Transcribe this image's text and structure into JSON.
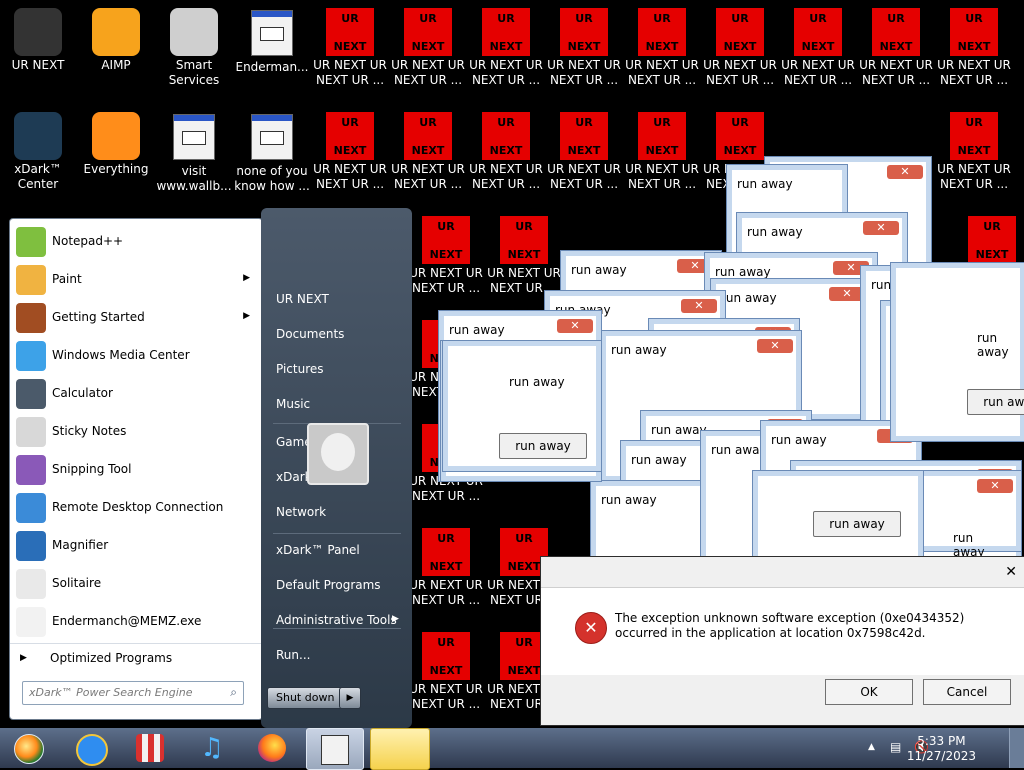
{
  "desktop_icons": {
    "row1": [
      {
        "label": "UR NEXT"
      },
      {
        "label": "AIMP"
      },
      {
        "label": "Smart Services"
      },
      {
        "label": "Enderman..."
      },
      {
        "label": "UR NEXT UR NEXT UR ..."
      },
      {
        "label": "UR NEXT UR NEXT UR ..."
      },
      {
        "label": "UR NEXT UR NEXT UR ..."
      },
      {
        "label": "UR NEXT UR NEXT UR ..."
      },
      {
        "label": "UR NEXT UR NEXT UR ..."
      },
      {
        "label": "UR NEXT UR NEXT UR ..."
      },
      {
        "label": "UR NEXT UR NEXT UR ..."
      },
      {
        "label": "UR NEXT UR NEXT UR ..."
      },
      {
        "label": "UR NEXT UR NEXT UR ..."
      }
    ],
    "row2": [
      {
        "label": "xDark™ Center"
      },
      {
        "label": "Everything"
      },
      {
        "label": "visit www.wallb..."
      },
      {
        "label": "none of you know how ..."
      },
      {
        "label": "UR NEXT UR NEXT UR ..."
      },
      {
        "label": "UR NEXT UR NEXT UR ..."
      },
      {
        "label": "UR NEXT UR NEXT UR ..."
      },
      {
        "label": "UR NEXT UR NEXT UR ..."
      },
      {
        "label": "UR NEXT UR NEXT UR ..."
      },
      {
        "label": "UR NEXT UR NEXT UR ..."
      },
      {
        "label": "UR NEXT UR NEXT UR ..."
      }
    ],
    "ur_tile": {
      "top": "UR",
      "bottom": "NEXT"
    }
  },
  "start_menu": {
    "programs": [
      {
        "label": "Notepad++",
        "submenu": false,
        "icon": "notepadpp-icon"
      },
      {
        "label": "Paint",
        "submenu": true,
        "icon": "paint-icon"
      },
      {
        "label": "Getting Started",
        "submenu": true,
        "icon": "getting-started-icon"
      },
      {
        "label": "Windows Media Center",
        "submenu": false,
        "icon": "media-center-icon"
      },
      {
        "label": "Calculator",
        "submenu": false,
        "icon": "calculator-icon"
      },
      {
        "label": "Sticky Notes",
        "submenu": false,
        "icon": "sticky-notes-icon"
      },
      {
        "label": "Snipping Tool",
        "submenu": false,
        "icon": "snipping-tool-icon"
      },
      {
        "label": "Remote Desktop Connection",
        "submenu": false,
        "icon": "remote-desktop-icon"
      },
      {
        "label": "Magnifier",
        "submenu": false,
        "icon": "magnifier-icon"
      },
      {
        "label": "Solitaire",
        "submenu": false,
        "icon": "solitaire-icon"
      },
      {
        "label": "Endermanch@MEMZ.exe",
        "submenu": false,
        "icon": "exe-icon"
      }
    ],
    "all_programs_label": "Optimized Programs",
    "search_placeholder": "xDark™ Power Search Engine",
    "right_items": [
      {
        "label": "UR NEXT"
      },
      {
        "label": "Documents"
      },
      {
        "label": "Pictures"
      },
      {
        "label": "Music"
      },
      {
        "label": "Games"
      },
      {
        "label": "xDark™ Center"
      },
      {
        "label": "Network"
      },
      {
        "label": "xDark™ Panel"
      },
      {
        "label": "Default Programs"
      },
      {
        "label": "Administrative Tools",
        "submenu": true
      },
      {
        "label": "Run..."
      }
    ],
    "shutdown_label": "Shut down"
  },
  "run_away": {
    "title": "run away",
    "message": "run away",
    "button": "run away"
  },
  "error_dialog": {
    "message": "The exception unknown software exception (0xe0434352) occurred in the application at location 0x7598c42d.",
    "ok_label": "OK",
    "cancel_label": "Cancel"
  },
  "taskbar": {
    "time": "5:33 PM",
    "date": "11/27/2023"
  }
}
